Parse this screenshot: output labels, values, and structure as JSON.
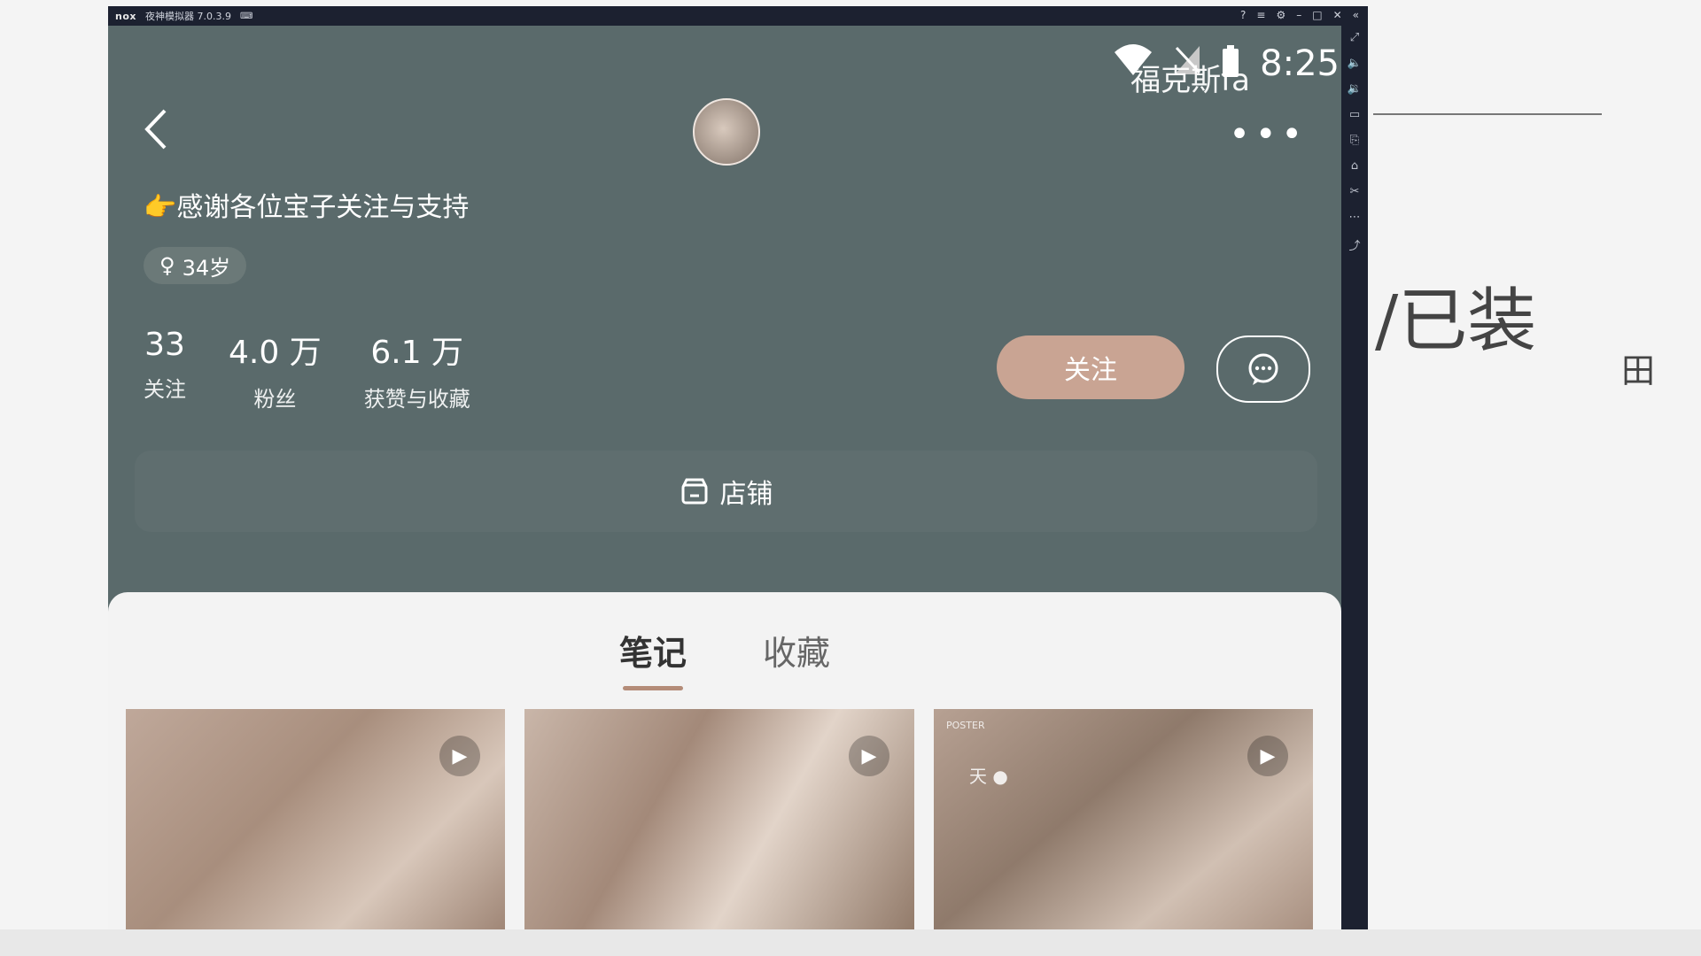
{
  "emulator": {
    "logo": "nox",
    "title": "夜神模拟器 7.0.3.9",
    "controls": [
      "?",
      "≡",
      "⚙",
      "–",
      "□",
      "✕",
      "«"
    ],
    "side_tools": [
      "⤢",
      "🔈",
      "🔉",
      "▭",
      "⎘",
      "⌂",
      "✂",
      "⋯",
      "⤴"
    ]
  },
  "status": {
    "time": "8:25",
    "overlay": "福克斯fa",
    "wifi_icon": "wifi-icon",
    "signal_icon": "no-signal-icon"
  },
  "profile": {
    "bio": "👉感谢各位宝子关注与支持",
    "age": "34岁",
    "stats": [
      {
        "num": "33",
        "label": "关注"
      },
      {
        "num": "4.0 万",
        "label": "粉丝"
      },
      {
        "num": "6.1 万",
        "label": "获赞与收藏"
      }
    ],
    "follow_label": "关注",
    "store_label": "店铺"
  },
  "tabs": [
    {
      "label": "笔记",
      "active": true
    },
    {
      "label": "收藏",
      "active": false
    }
  ],
  "posts": [
    {
      "caption": "",
      "caption2": ""
    },
    {
      "caption": "",
      "caption2": ""
    },
    {
      "caption": "POSTER",
      "caption2": "天 ●"
    }
  ],
  "whiteboard": {
    "scribble1": "/已装",
    "scribble2": "田"
  },
  "colors": {
    "screen_bg": "#5a6a6b",
    "follow_btn": "#c9a493",
    "tab_underline": "#b48c78"
  }
}
